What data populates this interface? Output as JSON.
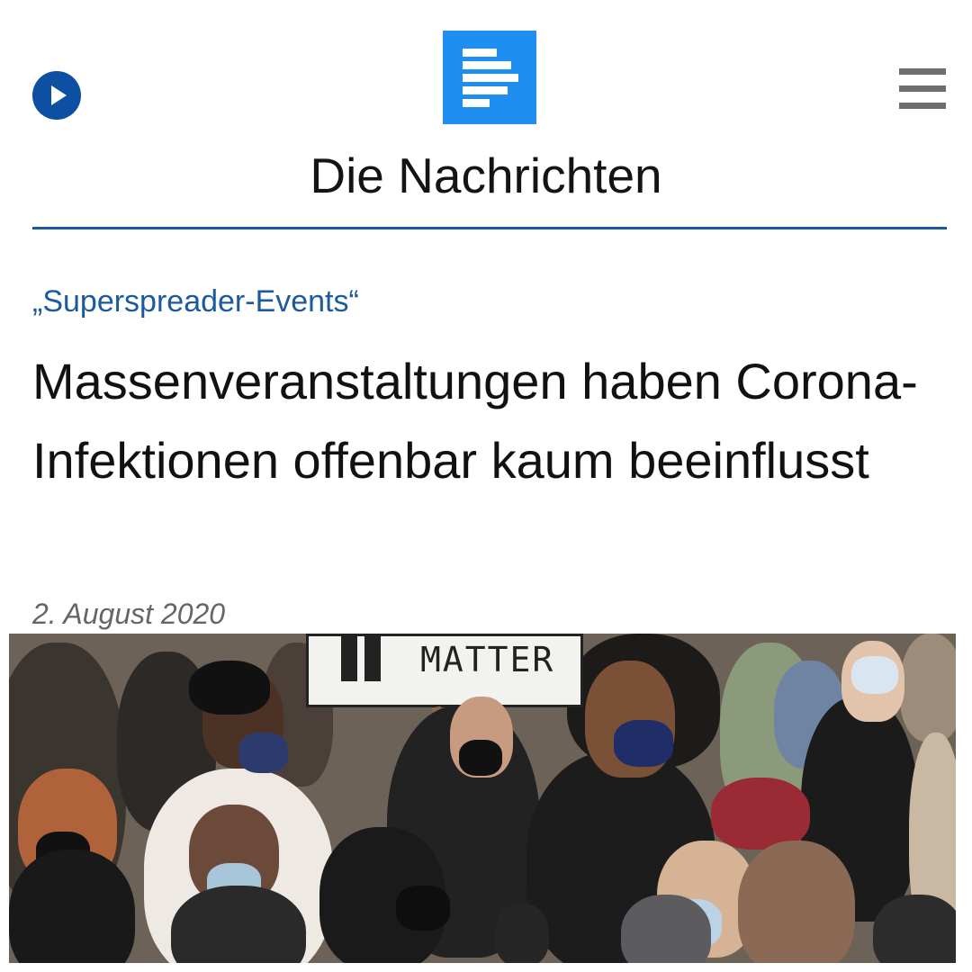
{
  "header": {
    "play_icon": "play-icon",
    "logo_icon": "document-logo-icon",
    "menu_icon": "hamburger-menu-icon",
    "title": "Die Nachrichten",
    "accent_color": "#1b5a9c",
    "logo_color": "#1e8ff0"
  },
  "article": {
    "kicker": "„Superspreader-Events“",
    "headline": "Massenveranstaltungen haben Corona-Infektionen offenbar kaum beeinflusst",
    "date": "2. August 2020"
  },
  "photo": {
    "sign_text": "MATTER"
  }
}
